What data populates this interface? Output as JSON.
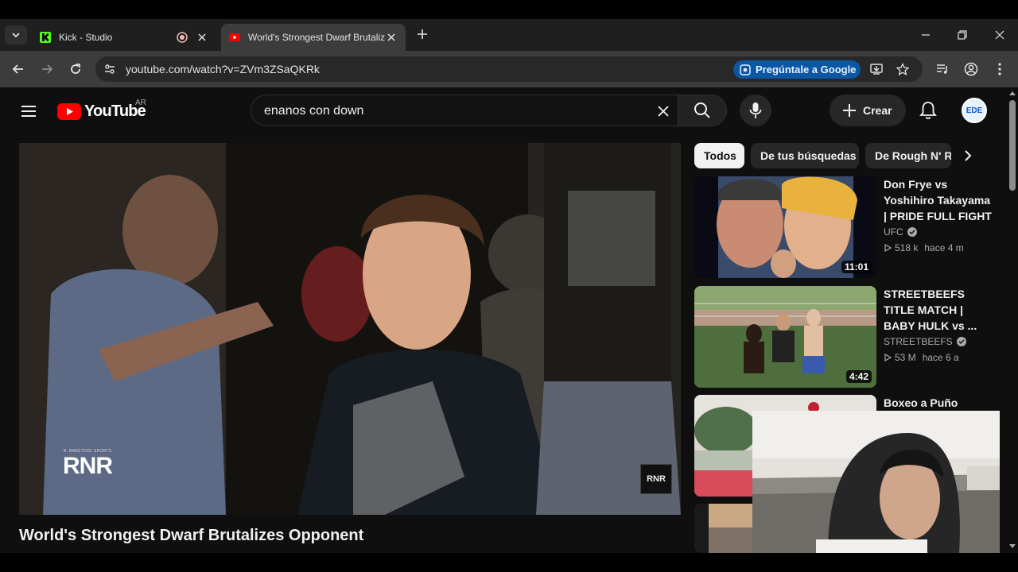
{
  "browser": {
    "tabs": [
      {
        "title": "Kick - Studio",
        "active": false
      },
      {
        "title": "World's Strongest Dwarf Brutaliz",
        "active": true
      }
    ],
    "url": "youtube.com/watch?v=ZVm3ZSaQKRk",
    "ask_google_label": "Pregúntale a Google"
  },
  "youtube": {
    "logo_text": "YouTube",
    "country_code": "AR",
    "search_query": "enanos con down",
    "create_label": "Crear",
    "avatar_text": "EDE",
    "video": {
      "title": "World's Strongest Dwarf Brutalizes Opponent",
      "watermark_left_small": "R. BARSTOOL SPORTS",
      "watermark_left_big": "RNR",
      "watermark_right": "RNR"
    },
    "chips": [
      "Todos",
      "De tus búsquedas",
      "De Rough N' R"
    ],
    "related": [
      {
        "title": "Don Frye vs Yoshihiro Takayama | PRIDE FULL FIGHT",
        "channel": "UFC",
        "views": "518 k",
        "age": "hace 4 m",
        "duration": "11:01"
      },
      {
        "title": "STREETBEEFS TITLE MATCH | BABY HULK vs ...",
        "channel": "STREETBEEFS",
        "views": "53 M",
        "age": "hace 6 a",
        "duration": "4:42"
      },
      {
        "title": "Boxeo a Puño",
        "channel": "",
        "views": "",
        "age": "",
        "duration": ""
      }
    ]
  },
  "colors": {
    "yt_red": "#ff0000",
    "page_bg": "#0f0f0f",
    "ask_google_bg": "#0b57a4",
    "kick_green": "#53fc18"
  }
}
